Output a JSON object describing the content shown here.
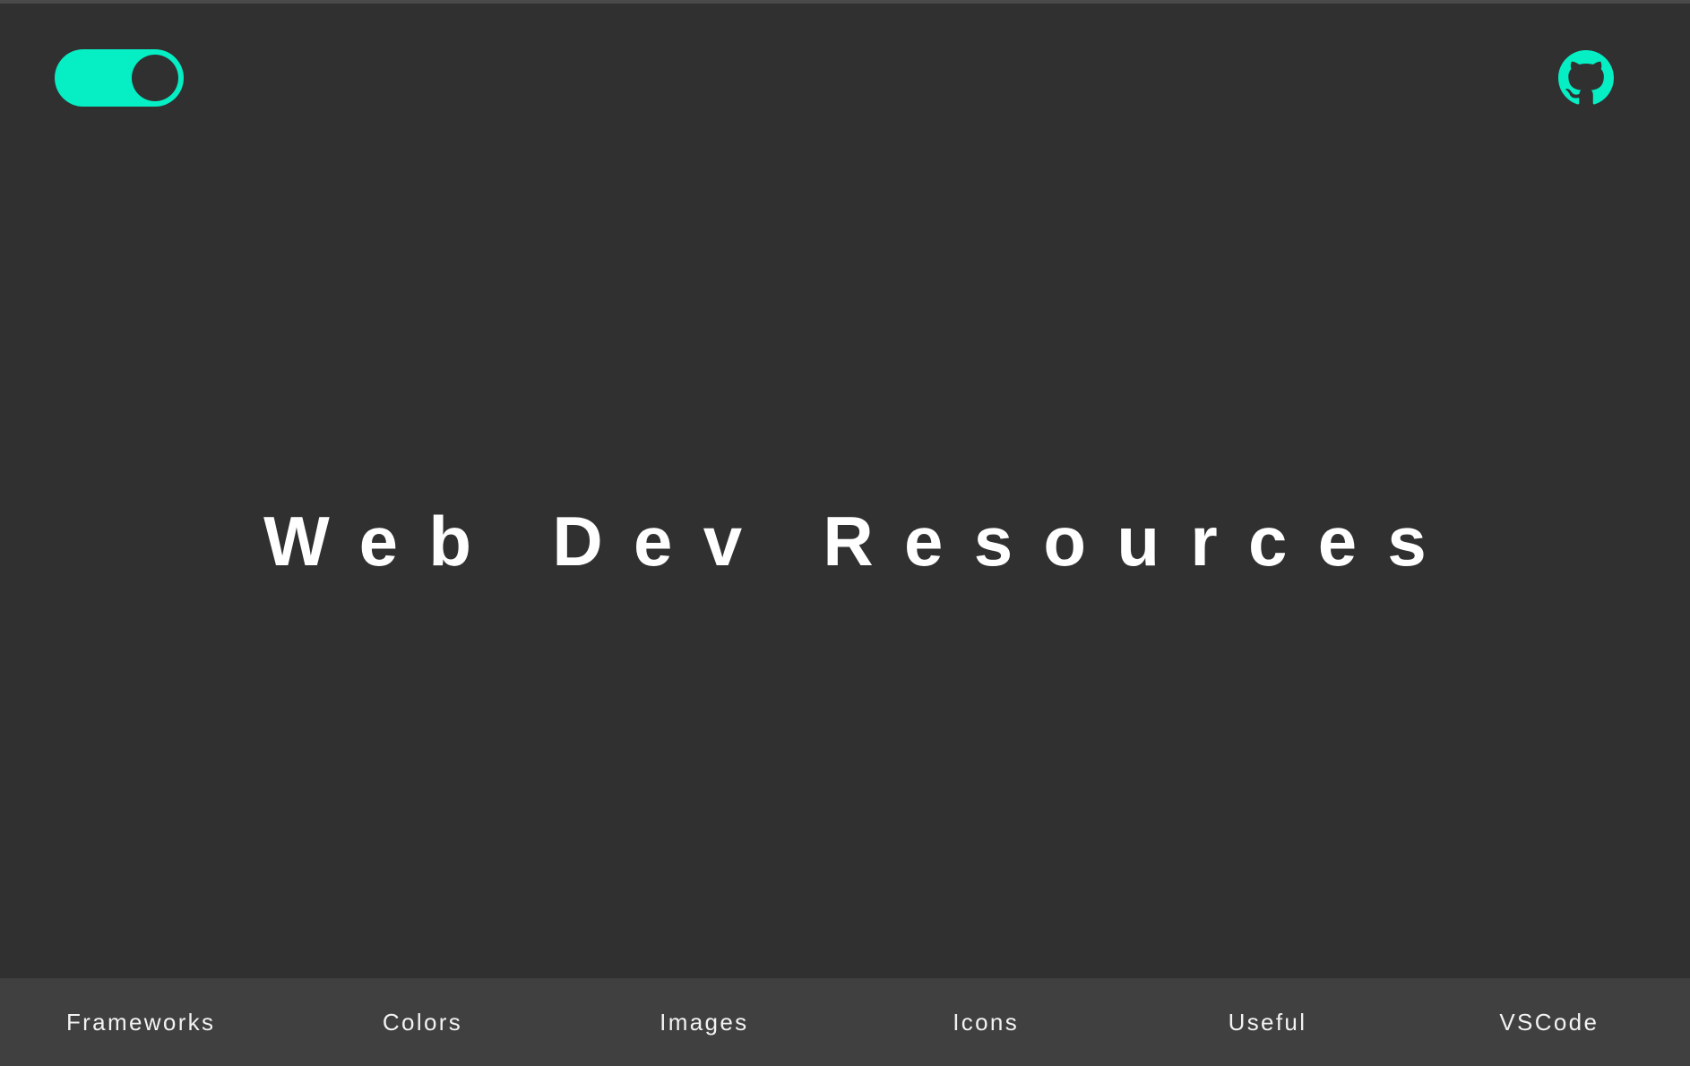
{
  "header": {
    "theme_toggle": {
      "state": "on",
      "accent_color": "#05eec4"
    },
    "github_link": {
      "icon": "github-icon",
      "color": "#05eec4"
    }
  },
  "hero": {
    "title": "Web Dev Resources"
  },
  "nav": {
    "items": [
      {
        "label": "Frameworks"
      },
      {
        "label": "Colors"
      },
      {
        "label": "Images"
      },
      {
        "label": "Icons"
      },
      {
        "label": "Useful"
      },
      {
        "label": "VSCode"
      }
    ]
  },
  "colors": {
    "background": "#303030",
    "nav_background": "#404040",
    "accent": "#05eec4",
    "text": "#ffffff"
  }
}
